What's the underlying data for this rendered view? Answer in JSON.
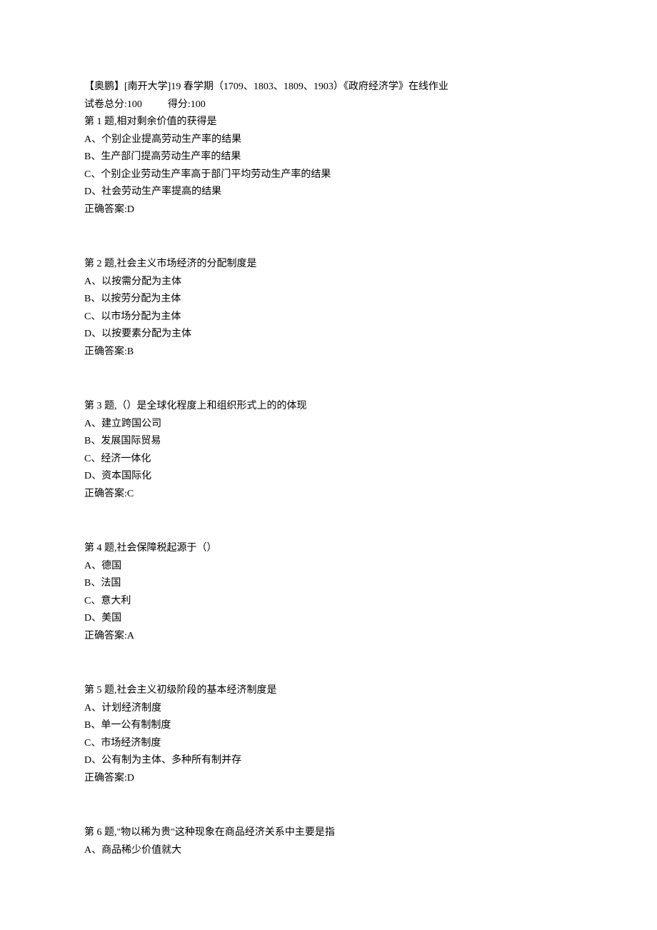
{
  "header": {
    "title": "【奥鹏】[南开大学]19 春学期（1709、1803、1809、1903）《政府经济学》在线作业",
    "score_total_label": "试卷总分:100",
    "score_got_label": "得分:100"
  },
  "questions": [
    {
      "prompt": "第 1 题,相对剩余价值的获得是",
      "options": [
        "A、个别企业提高劳动生产率的结果",
        "B、生产部门提高劳动生产率的结果",
        "C、个别企业劳动生产率高于部门平均劳动生产率的结果",
        "D、社会劳动生产率提高的结果"
      ],
      "answer": "正确答案:D"
    },
    {
      "prompt": "第 2 题,社会主义市场经济的分配制度是",
      "options": [
        "A、以按需分配为主体",
        "B、以按劳分配为主体",
        "C、以市场分配为主体",
        "D、以按要素分配为主体"
      ],
      "answer": "正确答案:B"
    },
    {
      "prompt": "第 3 题,（）是全球化程度上和组织形式上的的体现",
      "options": [
        "A、建立跨国公司",
        "B、发展国际贸易",
        "C、经济一体化",
        "D、资本国际化"
      ],
      "answer": "正确答案:C"
    },
    {
      "prompt": "第 4 题,社会保障税起源于（）",
      "options": [
        "A、德国",
        "B、法国",
        "C、意大利",
        "D、美国"
      ],
      "answer": "正确答案:A"
    },
    {
      "prompt": "第 5 题,社会主义初级阶段的基本经济制度是",
      "options": [
        "A、计划经济制度",
        "B、单一公有制制度",
        "C、市场经济制度",
        "D、公有制为主体、多种所有制并存"
      ],
      "answer": "正确答案:D"
    },
    {
      "prompt": "第 6 题,\"物以稀为贵\"这种现象在商品经济关系中主要是指",
      "options": [
        "A、商品稀少价值就大"
      ],
      "answer": ""
    }
  ]
}
